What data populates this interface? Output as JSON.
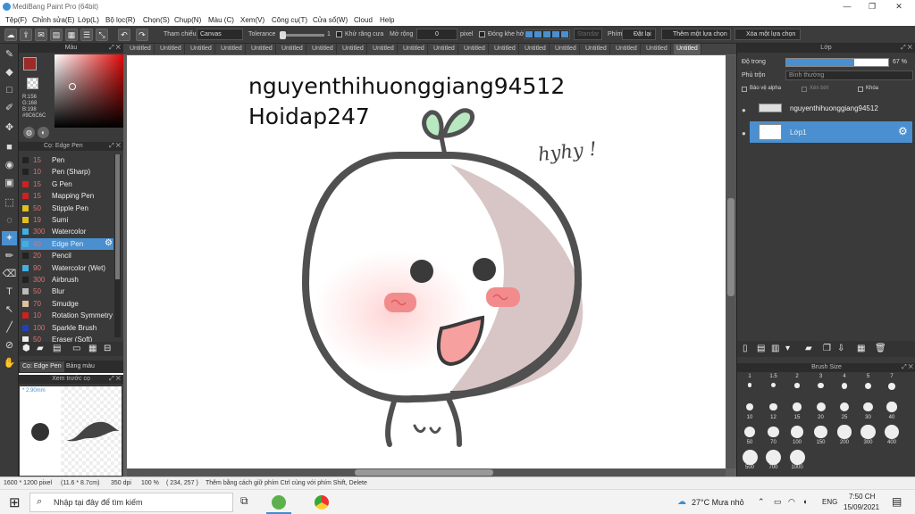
{
  "window": {
    "title": "MediBang Paint Pro (64bit)",
    "minimize": "—",
    "maximize": "❐",
    "close": "✕"
  },
  "menu": [
    "Tệp(F)",
    "Chỉnh sửa(E)",
    "Lớp(L)",
    "Bộ lọc(R)",
    "Chọn(S)",
    "Chụp(N)",
    "Màu (C)",
    "Xem(V)",
    "Công cụ(T)",
    "Cửa sổ(W)",
    "Cloud",
    "Help"
  ],
  "toolbar": {
    "reference_label": "Tham chiếu",
    "reference_value": "Canvas",
    "tolerance_label": "Tolerance",
    "tolerance_value": "1",
    "antialias_label": "Khử răng cưa",
    "expand_label": "Mở rộng",
    "expand_value": "0",
    "expand_unit": "pixel",
    "close_gap_label": "Đóng khe hở",
    "fill_label": "Nét bút",
    "fill_value": "Standar",
    "key_label": "Phím",
    "deselect_label": "Đặt lại",
    "add_selection_label": "Thêm một lựa chọn",
    "remove_selection_label": "Xóa một lựa chọn"
  },
  "color_panel": {
    "title": "Màu",
    "r": "R:156",
    "g": "G:168",
    "b": "B:198",
    "hex": "#9C6C6C",
    "main_color": "#9c2a2a"
  },
  "pen_panel": {
    "title": "Cọ: Edge Pen",
    "brushes": [
      {
        "size": "15",
        "name": "Pen",
        "color": "#222222"
      },
      {
        "size": "10",
        "name": "Pen (Sharp)",
        "color": "#222222"
      },
      {
        "size": "15",
        "name": "G Pen",
        "color": "#d02020"
      },
      {
        "size": "15",
        "name": "Mapping Pen",
        "color": "#d02020"
      },
      {
        "size": "50",
        "name": "Stipple Pen",
        "color": "#e0c020"
      },
      {
        "size": "19",
        "name": "Sumi",
        "color": "#e0c020"
      },
      {
        "size": "300",
        "name": "Watercolor",
        "color": "#40b0e0"
      },
      {
        "size": "40",
        "name": "Edge Pen",
        "color": "#40b0e0"
      },
      {
        "size": "20",
        "name": "Pencil",
        "color": "#222222"
      },
      {
        "size": "90",
        "name": "Watercolor (Wet)",
        "color": "#40b0e0"
      },
      {
        "size": "300",
        "name": "Airbrush",
        "color": "#222222"
      },
      {
        "size": "50",
        "name": "Blur",
        "color": "#bbbbbb"
      },
      {
        "size": "70",
        "name": "Smudge",
        "color": "#e0c0a0"
      },
      {
        "size": "10",
        "name": "Rotation Symmetry",
        "color": "#d02020"
      },
      {
        "size": "100",
        "name": "Sparkle Brush",
        "color": "#2040c0"
      },
      {
        "size": "50",
        "name": "Eraser (Soft)",
        "color": "#eeeeee"
      }
    ],
    "selected_index": 7,
    "tab1": "Cọ: Edge Pen",
    "tab2": "Bảng màu"
  },
  "preview_panel": {
    "title": "Xem trước cọ",
    "size_label": "* 2.90mm"
  },
  "tabs": [
    "Untitled",
    "Untitled",
    "Untitled",
    "Untitled",
    "Untitled",
    "Untitled",
    "Untitled",
    "Untitled",
    "Untitled",
    "Untitled",
    "Untitled",
    "Untitled",
    "Untitled",
    "Untitled",
    "Untitled",
    "Untitled",
    "Untitled",
    "Untitled",
    "Untitled"
  ],
  "canvas": {
    "line1": "nguyenthihuonggiang94512",
    "line2": "Hoidap247",
    "handwriting": "hyhy !"
  },
  "layer_panel": {
    "title": "Lớp",
    "opacity_label": "Độ trong",
    "opacity_value": "67 %",
    "opacity_fraction": 0.67,
    "blend_label": "Phủ trộn",
    "blend_value": "Bình thường",
    "protect_alpha": "Bảo vệ alpha",
    "clipping": "Xén bớt",
    "lock": "Khóa",
    "layers": [
      {
        "name": "nguyenthihuonggiang94512",
        "selected": false
      },
      {
        "name": "Lớp1",
        "selected": true
      }
    ]
  },
  "brush_size_panel": {
    "title": "Brush Size",
    "sizes": [
      "1",
      "1.5",
      "2",
      "3",
      "4",
      "5",
      "7",
      "10",
      "12",
      "15",
      "20",
      "25",
      "30",
      "40",
      "50",
      "70",
      "100",
      "150",
      "200",
      "300",
      "400",
      "500",
      "700",
      "1000"
    ]
  },
  "status": {
    "dimensions": "1600 * 1200 pixel",
    "physical": "(11.6 * 8.7cm)",
    "dpi": "350 dpi",
    "zoom": "100 %",
    "coords": "( 234, 257 )",
    "hint": "Thêm bằng cách giữ phím Ctrl cùng với phím Shift, Delete"
  },
  "taskbar": {
    "search_placeholder": "Nhập tại đây để tìm kiếm",
    "weather": "27°C  Mưa nhỏ",
    "lang": "ENG",
    "time": "7:50 CH",
    "date": "15/09/2021"
  }
}
